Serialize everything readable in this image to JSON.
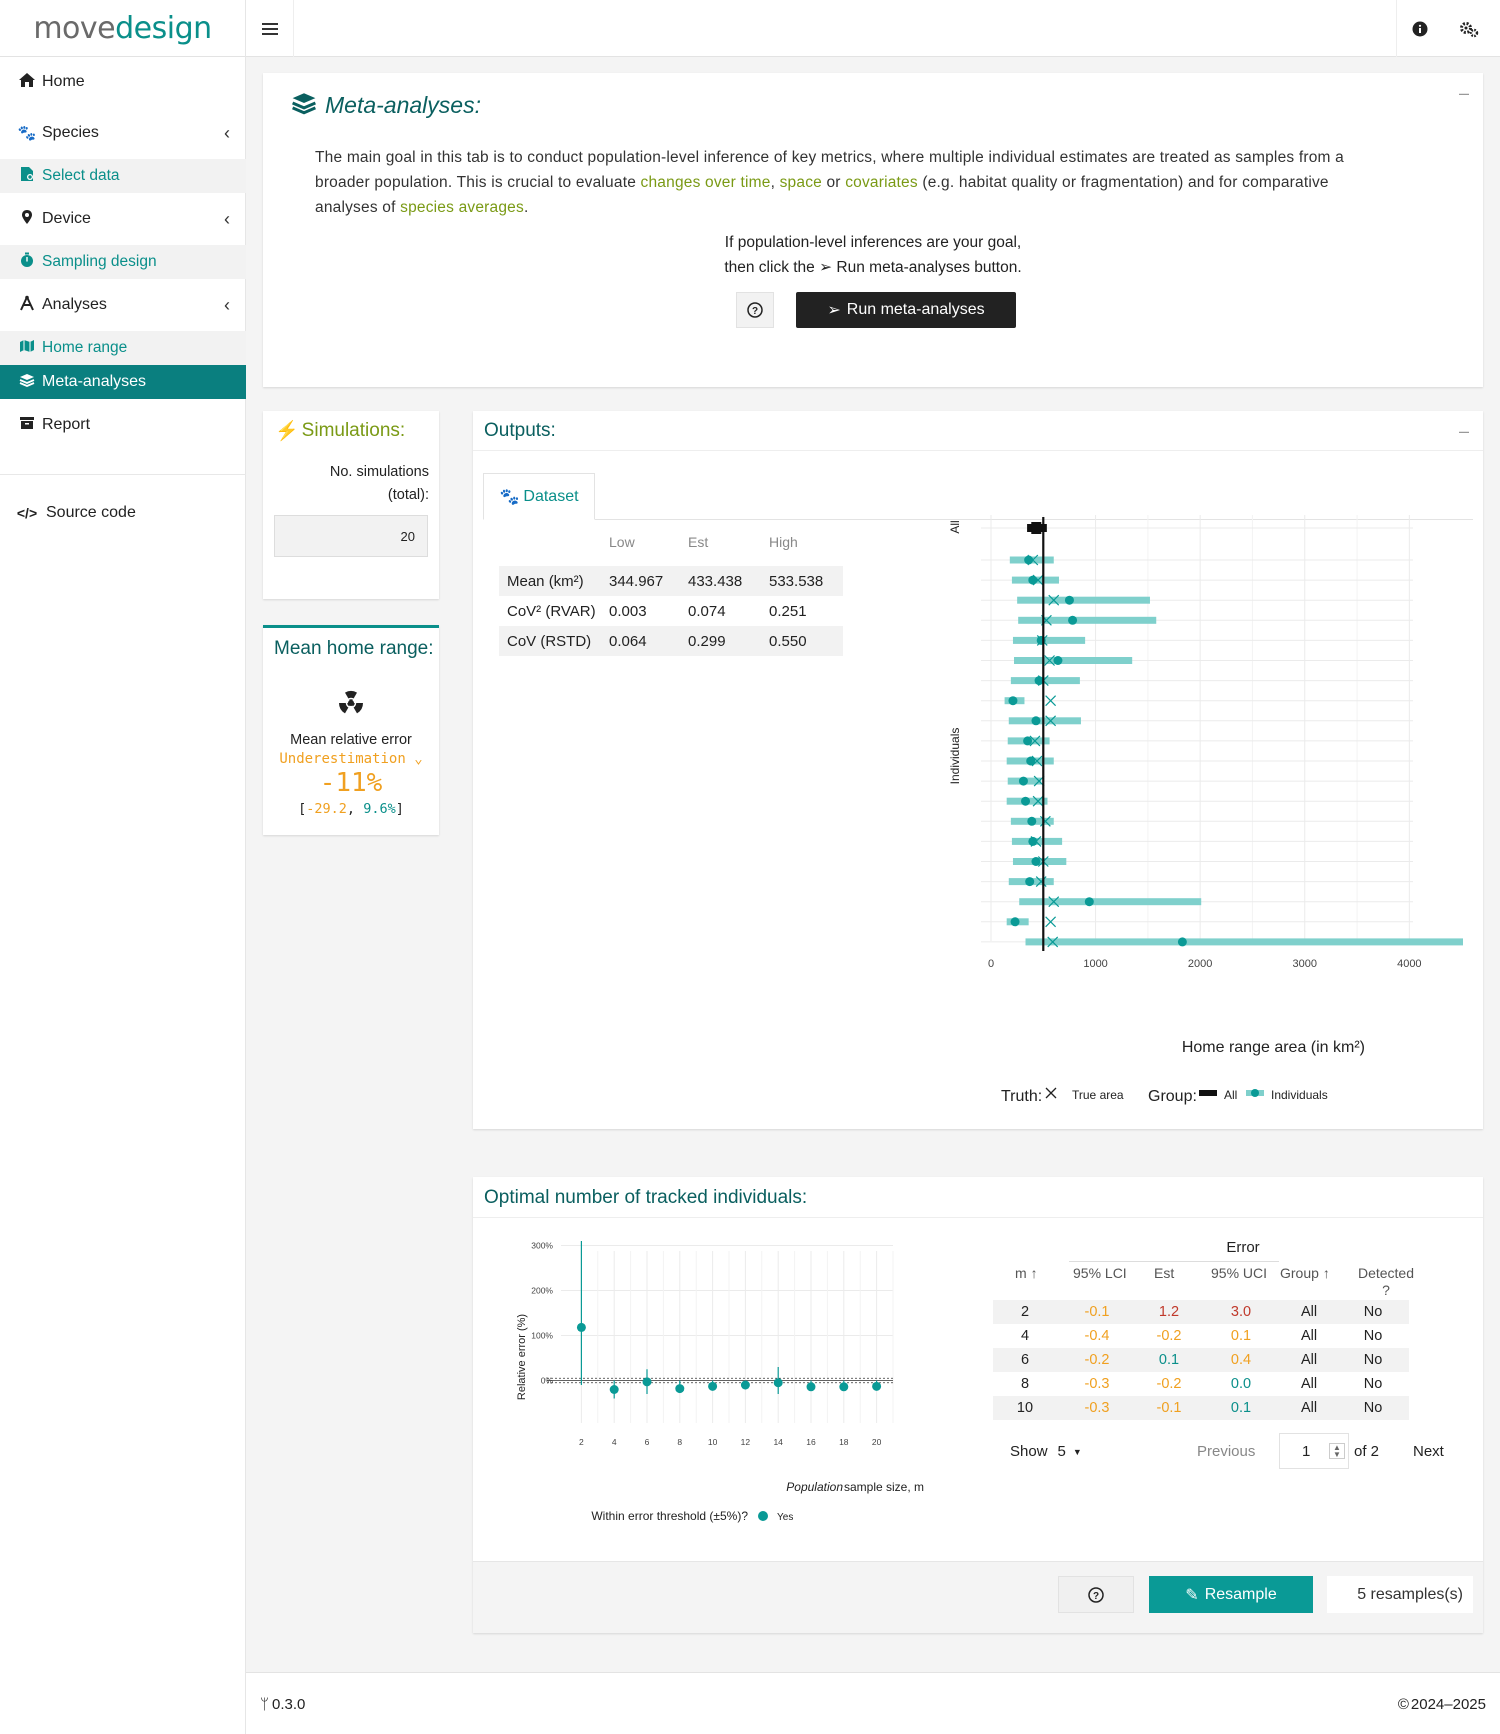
{
  "app": {
    "logo_left": "move",
    "logo_right": "design"
  },
  "topbar": {
    "menu_icon": "hamburger-icon",
    "info_icon": "info-icon",
    "settings_icon": "gears-icon"
  },
  "sidebar": {
    "items": [
      {
        "label": "Home",
        "icon": "home-icon"
      },
      {
        "label": "Species",
        "icon": "paw-icon"
      },
      {
        "label": "Select data",
        "icon": "file-icon"
      },
      {
        "label": "Device",
        "icon": "map-pin-icon"
      },
      {
        "label": "Sampling design",
        "icon": "stopwatch-icon"
      },
      {
        "label": "Analyses",
        "icon": "compass-icon"
      },
      {
        "label": "Home range",
        "icon": "map-icon"
      },
      {
        "label": "Meta-analyses",
        "icon": "layers-icon"
      },
      {
        "label": "Report",
        "icon": "archive-icon"
      },
      {
        "label": "Source code",
        "icon": "code-icon"
      }
    ]
  },
  "intro": {
    "title": "Meta-analyses:",
    "p1_a": "The main goal in this tab is to conduct population-level inference of key metrics, where multiple individual estimates are treated as samples from a",
    "p1_b": "broader population. This is crucial to evaluate ",
    "link_time": "changes over time",
    "comma": ", ",
    "link_space": "space",
    "or": " or ",
    "link_cov": "covariates",
    "p1_c": " (e.g. habitat quality or fragmentation) and for comparative",
    "p1_d": "analyses of ",
    "link_species": "species averages",
    "p1_e": ".",
    "goal_1": "If population-level inferences are your goal,",
    "goal_2": "then click the",
    "goal_3": "Run meta-analyses button.",
    "help_icon": "question-circle-icon",
    "run_button": "Run meta-analyses"
  },
  "simulations": {
    "title": "Simulations:",
    "label_1": "No. simulations",
    "label_2": "(total):",
    "value": "20"
  },
  "mean_hr": {
    "title": "Mean home range:",
    "icon": "radiation-icon",
    "label": "Mean relative error",
    "direction": "Underestimation",
    "value": "-11%",
    "ci_open": "[",
    "ci_low": "-29.2",
    "ci_sep": ", ",
    "ci_high": "9.6%",
    "ci_close": "]",
    "colors": {
      "orange": "#f0a020",
      "teal": "#0a8f8a"
    }
  },
  "outputs": {
    "title": "Outputs:",
    "tab": "Dataset",
    "table": {
      "headers": [
        "",
        "Low",
        "Est",
        "High"
      ],
      "rows": [
        [
          "Mean (km²)",
          "344.967",
          "433.438",
          "533.538"
        ],
        [
          "CoV² (RVAR)",
          "0.003",
          "0.074",
          "0.251"
        ],
        [
          "CoV (RSTD)",
          "0.064",
          "0.299",
          "0.550"
        ]
      ]
    }
  },
  "chart_data": [
    {
      "type": "scatter",
      "title": "",
      "xlabel": "Home range area (in km²)",
      "ylabel": "Individuals",
      "group_label_all": "All",
      "xlim": [
        0,
        4800
      ],
      "xticks": [
        0,
        1000,
        2000,
        3000,
        4000
      ],
      "truth_value": 500,
      "all": {
        "low": 345,
        "est": 433,
        "high": 534
      },
      "individuals": [
        {
          "low": 180,
          "est": 360,
          "high": 600,
          "truth": 400
        },
        {
          "low": 200,
          "est": 400,
          "high": 650,
          "truth": 450
        },
        {
          "low": 250,
          "est": 750,
          "high": 1520,
          "truth": 600
        },
        {
          "low": 260,
          "est": 780,
          "high": 1580,
          "truth": 530
        },
        {
          "low": 210,
          "est": 480,
          "high": 900,
          "truth": 490
        },
        {
          "low": 220,
          "est": 640,
          "high": 1350,
          "truth": 560
        },
        {
          "low": 190,
          "est": 460,
          "high": 850,
          "truth": 500
        },
        {
          "low": 130,
          "est": 210,
          "high": 320,
          "truth": 570
        },
        {
          "low": 170,
          "est": 430,
          "high": 860,
          "truth": 570
        },
        {
          "low": 160,
          "est": 350,
          "high": 560,
          "truth": 420
        },
        {
          "low": 150,
          "est": 380,
          "high": 600,
          "truth": 440
        },
        {
          "low": 160,
          "est": 310,
          "high": 480,
          "truth": 460
        },
        {
          "low": 150,
          "est": 330,
          "high": 540,
          "truth": 450
        },
        {
          "low": 190,
          "est": 390,
          "high": 600,
          "truth": 520
        },
        {
          "low": 200,
          "est": 400,
          "high": 680,
          "truth": 430
        },
        {
          "low": 210,
          "est": 430,
          "high": 720,
          "truth": 500
        },
        {
          "low": 170,
          "est": 370,
          "high": 600,
          "truth": 480
        },
        {
          "low": 270,
          "est": 940,
          "high": 2010,
          "truth": 600
        },
        {
          "low": 150,
          "est": 230,
          "high": 360,
          "truth": 570
        },
        {
          "low": 330,
          "est": 1830,
          "high": 4700,
          "truth": 590
        }
      ],
      "legend": {
        "truth_title": "Truth:",
        "truth_item": "True area",
        "group_title": "Group:",
        "group_all": "All",
        "group_ind": "Individuals"
      },
      "colors": {
        "all": "#111111",
        "individuals": "#0a9a96",
        "ci": "#7fd0cc"
      }
    },
    {
      "type": "scatter",
      "title": "",
      "xlabel_italic": "Population",
      "xlabel_rest": "sample size, m",
      "ylabel": "Relative error (%)",
      "x": [
        2,
        4,
        6,
        8,
        10,
        12,
        14,
        16,
        18,
        20
      ],
      "est": [
        118,
        -20,
        -3,
        -18,
        -13,
        -10,
        -5,
        -14,
        -14,
        -13
      ],
      "low": [
        -10,
        -40,
        -30,
        -20,
        -20,
        -20,
        -30,
        -20,
        -20,
        -20
      ],
      "high": [
        310,
        0,
        25,
        0,
        0,
        0,
        30,
        0,
        0,
        0
      ],
      "yticks": [
        "0%",
        "100%",
        "200%",
        "300%"
      ],
      "ylim": [
        -50,
        310
      ],
      "threshold": 5,
      "legend": {
        "title": "Within error threshold (±5%)?",
        "item": "Yes"
      },
      "colors": {
        "point": "#0a9a96"
      }
    }
  ],
  "optimal": {
    "title": "Optimal number of tracked individuals:",
    "error_header": "Error",
    "columns": [
      "m",
      "95% LCI",
      "Est",
      "95% UCI",
      "Group",
      "Detected ?"
    ],
    "sort_arrow": "↑",
    "rows": [
      {
        "m": "2",
        "lci": "-0.1",
        "est": "1.2",
        "uci": "3.0",
        "group": "All",
        "det": "No",
        "c_lci": "#f0a020",
        "c_est": "#c0392b",
        "c_uci": "#c0392b"
      },
      {
        "m": "4",
        "lci": "-0.4",
        "est": "-0.2",
        "uci": "0.1",
        "group": "All",
        "det": "No",
        "c_lci": "#f0a020",
        "c_est": "#f0a020",
        "c_uci": "#f0a020"
      },
      {
        "m": "6",
        "lci": "-0.2",
        "est": "0.1",
        "uci": "0.4",
        "group": "All",
        "det": "No",
        "c_lci": "#f0a020",
        "c_est": "#0a8f8a",
        "c_uci": "#f0a020"
      },
      {
        "m": "8",
        "lci": "-0.3",
        "est": "-0.2",
        "uci": "0.0",
        "group": "All",
        "det": "No",
        "c_lci": "#f0a020",
        "c_est": "#f0a020",
        "c_uci": "#0a8f8a"
      },
      {
        "m": "10",
        "lci": "-0.3",
        "est": "-0.1",
        "uci": "0.1",
        "group": "All",
        "det": "No",
        "c_lci": "#f0a020",
        "c_est": "#f0a020",
        "c_uci": "#0a8f8a"
      }
    ],
    "show_label": "Show",
    "show_value": "5",
    "previous": "Previous",
    "page": "1",
    "of": "of 2",
    "next": "Next",
    "resample": "Resample",
    "resamples": "5 resamples(s)"
  },
  "footer": {
    "version": "0.3.0",
    "copyright": "2024–2025"
  }
}
